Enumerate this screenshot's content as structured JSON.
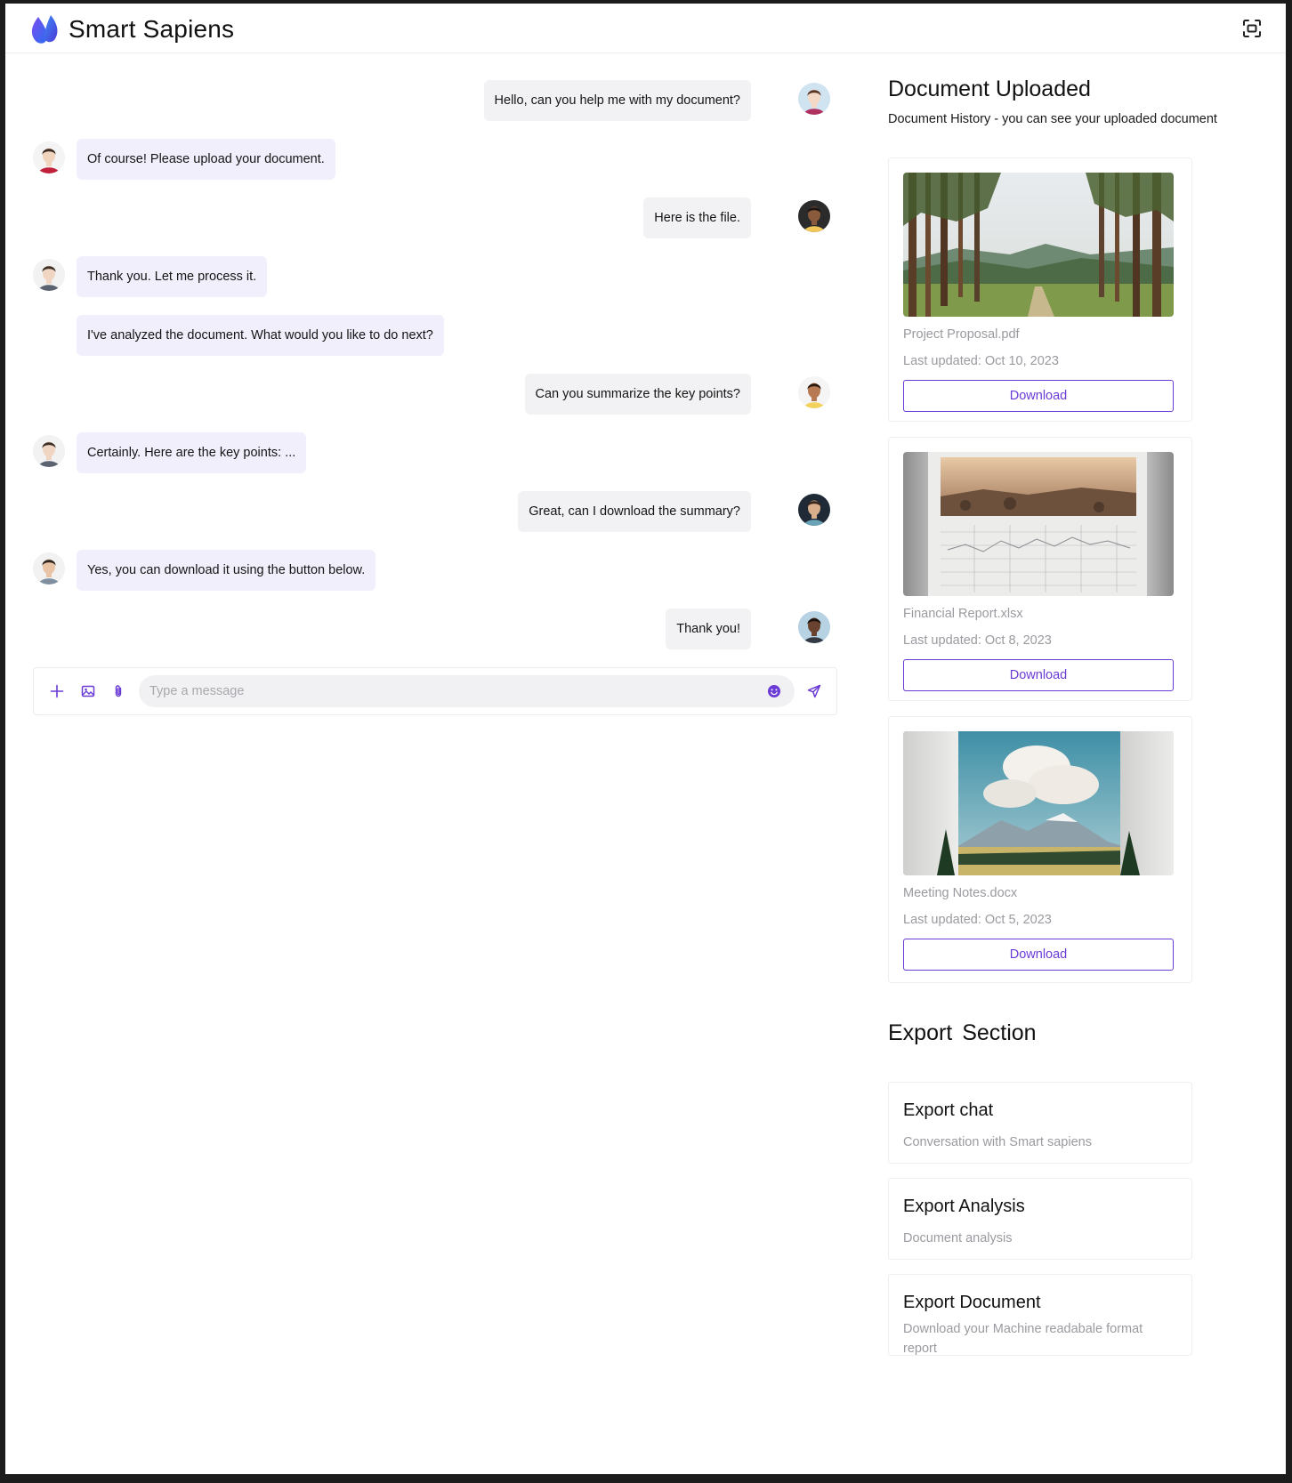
{
  "app": {
    "title": "Smart Sapiens",
    "accent": "#6b3bd6"
  },
  "messages": [
    {
      "side": "right",
      "text": "Hello, can you help me with my document?",
      "avatar": "woman-brown-hair"
    },
    {
      "side": "left",
      "text": "Of course! Please upload your document.",
      "avatar": "man-red-shirt"
    },
    {
      "side": "right",
      "text": "Here is the file.",
      "avatar": "woman-dark-hair"
    },
    {
      "side": "left",
      "text": "Thank you. Let me process it.",
      "avatar": "man-suit"
    },
    {
      "side": "left",
      "text": "I've analyzed the document. What would you like to do next?",
      "avatar": ""
    },
    {
      "side": "right",
      "text": "Can you summarize the key points?",
      "avatar": "woman-curly-hair"
    },
    {
      "side": "left",
      "text": "Certainly. Here are the key points: ...",
      "avatar": "man-suit"
    },
    {
      "side": "right",
      "text": "Great, can I download the summary?",
      "avatar": "man-beard"
    },
    {
      "side": "left",
      "text": "Yes, you can download it using the button below.",
      "avatar": "man-glasses"
    },
    {
      "side": "right",
      "text": "Thank you!",
      "avatar": "man-dark"
    }
  ],
  "composer": {
    "placeholder": "Type a message"
  },
  "documents": {
    "title": "Document Uploaded",
    "subtitle": "Document History - you can see your uploaded document",
    "items": [
      {
        "name": "Project Proposal.pdf",
        "updated": "Last updated: Oct 10, 2023",
        "button": "Download",
        "thumb": "forest"
      },
      {
        "name": "Financial Report.xlsx",
        "updated": "Last updated: Oct 8, 2023",
        "button": "Download",
        "thumb": "report"
      },
      {
        "name": "Meeting Notes.docx",
        "updated": "Last updated: Oct 5, 2023",
        "button": "Download",
        "thumb": "mountain"
      }
    ]
  },
  "export": {
    "title": "Export  Section",
    "items": [
      {
        "title": "Export chat",
        "desc": "Conversation with Smart sapiens"
      },
      {
        "title": "Export Analysis",
        "desc": "Document analysis"
      },
      {
        "title": "Export Document",
        "desc": "Download your Machine readabale format report"
      }
    ]
  }
}
